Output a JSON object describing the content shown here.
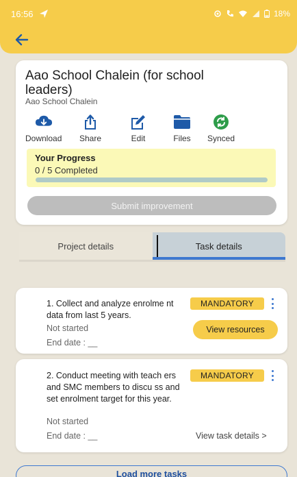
{
  "status_bar": {
    "time": "16:56",
    "battery": "18%"
  },
  "project": {
    "title": "Aao School Chalein (for school leaders)",
    "subtitle": "Aao School Chalein",
    "actions": [
      {
        "label": "Download",
        "icon": "cloud-download-icon"
      },
      {
        "label": "Share",
        "icon": "share-icon"
      },
      {
        "label": "Edit",
        "icon": "edit-icon"
      },
      {
        "label": "Files",
        "icon": "folder-icon"
      },
      {
        "label": "Synced",
        "icon": "sync-icon"
      }
    ],
    "progress": {
      "title": "Your Progress",
      "count_text": "0 / 5 Completed",
      "fraction": 0
    },
    "submit_label": "Submit improvement"
  },
  "tabs": {
    "project_details": "Project details",
    "task_details": "Task details"
  },
  "tasks": [
    {
      "text": "1. Collect and analyze enrolme nt data from last 5 years.",
      "badge": "MANDATORY",
      "status": "Not started",
      "end_date": "End date : __",
      "action": "View resources"
    },
    {
      "text": "2. Conduct meeting with teach ers and SMC members to discu ss and set enrolment target for this year.",
      "badge": "MANDATORY",
      "status": "Not started",
      "end_date": "End date : __",
      "action": "View task details >"
    }
  ],
  "load_more": "Load more tasks",
  "colors": {
    "accent_yellow": "#f6cc4a",
    "primary_blue": "#1e5aa8",
    "synced_green": "#2e9d4a",
    "background": "#e9e4d8"
  }
}
